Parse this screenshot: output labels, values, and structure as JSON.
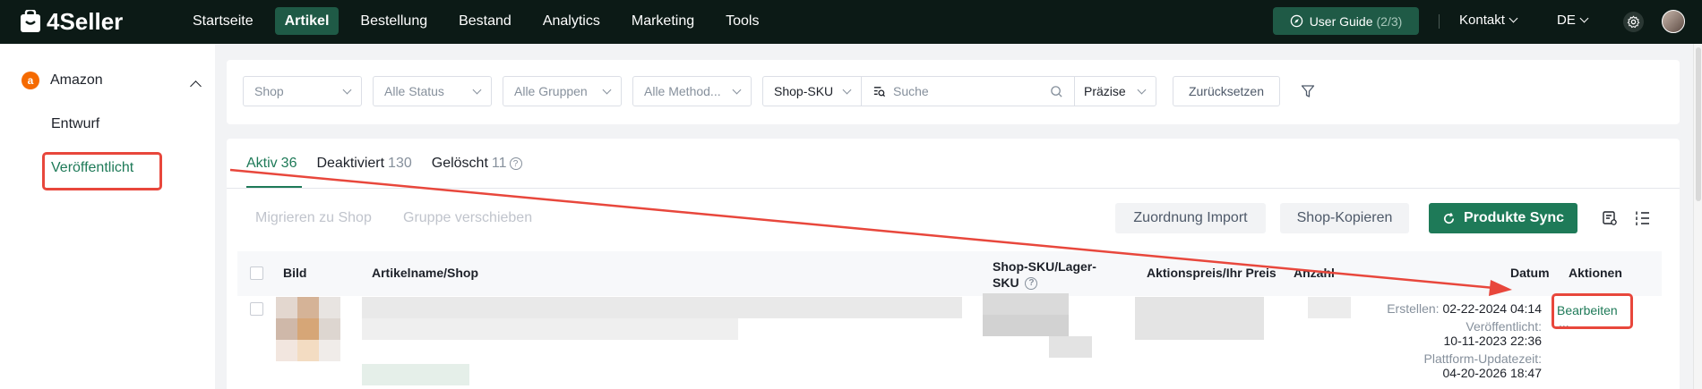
{
  "app": {
    "name": "4Seller"
  },
  "nav": {
    "items": [
      "Startseite",
      "Artikel",
      "Bestellung",
      "Bestand",
      "Analytics",
      "Marketing",
      "Tools"
    ],
    "active_index": 1
  },
  "header": {
    "user_guide_label": "User Guide",
    "user_guide_count": "(2/3)",
    "kontakt_label": "Kontakt",
    "lang_label": "DE"
  },
  "sidebar": {
    "group_label": "Amazon",
    "group_icon": "amazon-a",
    "items": [
      "Entwurf",
      "Veröffentlicht"
    ],
    "active_index": 1
  },
  "filters": {
    "shop_placeholder": "Shop",
    "status_placeholder": "Alle Status",
    "groups_placeholder": "Alle Gruppen",
    "method_placeholder": "Alle Method...",
    "search_field_type": "Shop-SKU",
    "search_placeholder": "Suche",
    "match_mode": "Präzise",
    "reset_label": "Zurücksetzen"
  },
  "tabs": [
    {
      "label": "Aktiv",
      "count": "36"
    },
    {
      "label": "Deaktiviert",
      "count": "130"
    },
    {
      "label": "Gelöscht",
      "count": "11"
    }
  ],
  "actions": {
    "migrate_label": "Migrieren zu Shop",
    "move_group_label": "Gruppe verschieben",
    "import_label": "Zuordnung Import",
    "copy_label": "Shop-Kopieren",
    "sync_label": "Produkte Sync"
  },
  "table": {
    "columns": {
      "bild": "Bild",
      "name": "Artikelname/Shop",
      "sku_line1": "Shop-SKU/Lager-",
      "sku_line2": "SKU",
      "price": "Aktionspreis/Ihr Preis",
      "amount": "Anzahl",
      "date": "Datum",
      "actions": "Aktionen"
    },
    "row": {
      "created_label": "Erstellen:",
      "created_value": "02-22-2024 04:14",
      "published_label": "Veröffentlicht:",
      "published_value": "10-11-2023 22:36",
      "updated_label": "Plattform-Updatezeit:",
      "updated_value": "04-20-2026 18:47",
      "edit_label": "Bearbeiten",
      "more_label": "..."
    }
  },
  "colors": {
    "topbar_bg": "#0c1a16",
    "accent_green": "#1e7a58",
    "annotation_red": "#e8473c"
  }
}
